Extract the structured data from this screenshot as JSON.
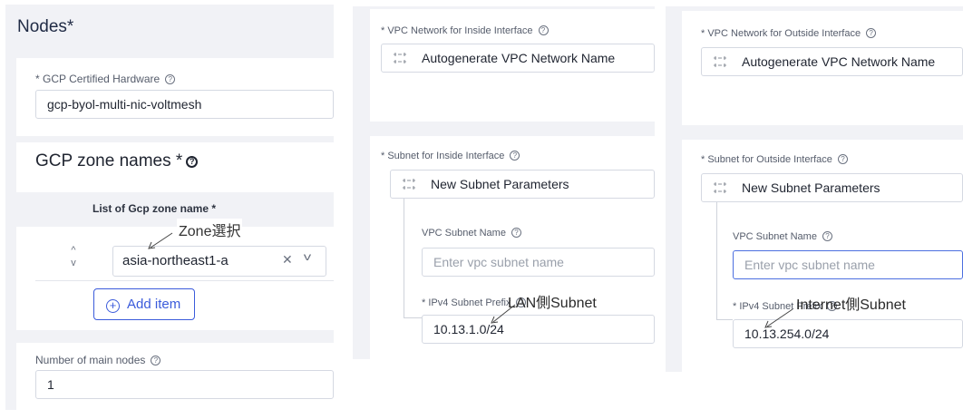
{
  "left": {
    "nodes_title": "Nodes",
    "required_mark": "*",
    "hardware_label": "* GCP Certified Hardware",
    "hardware_value": "gcp-byol-multi-nic-voltmesh",
    "zones_title": "GCP zone names *",
    "list_header": "List of Gcp zone name *",
    "zone_annotation": "Zone選択",
    "zone_value": "asia-northeast1-a",
    "add_item_label": "Add item",
    "main_nodes_label": "Number of main nodes",
    "main_nodes_value": "1"
  },
  "inside": {
    "vpc_label": "* VPC Network for Inside Interface",
    "vpc_value": "Autogenerate VPC Network Name",
    "subnet_label": "* Subnet for Inside Interface",
    "subnet_value": "New Subnet Parameters",
    "subnet_name_label": "VPC Subnet Name",
    "subnet_name_placeholder": "Enter vpc subnet name",
    "prefix_label": "* IPv4 Subnet Prefix",
    "prefix_value": "10.13.1.0/24",
    "annotation": "LAN側Subnet"
  },
  "outside": {
    "vpc_label": "* VPC Network for Outside Interface",
    "vpc_value": "Autogenerate VPC Network Name",
    "subnet_label": "* Subnet for Outside Interface",
    "subnet_value": "New Subnet Parameters",
    "subnet_name_label": "VPC Subnet Name",
    "subnet_name_placeholder": "Enter vpc subnet name",
    "prefix_label": "* IPv4 Subnet Prefix",
    "prefix_value": "10.13.254.0/24",
    "annotation": "Internet側Subnet"
  },
  "icons": {
    "help": "help-circle-icon",
    "network": "network-icon",
    "clear": "close-icon",
    "dropdown": "chevron-down-icon",
    "add": "plus-circle-icon"
  },
  "colors": {
    "accent": "#3b5bdb",
    "panel_bg": "#f1f2f6",
    "focus_border": "#4c6fe0"
  }
}
